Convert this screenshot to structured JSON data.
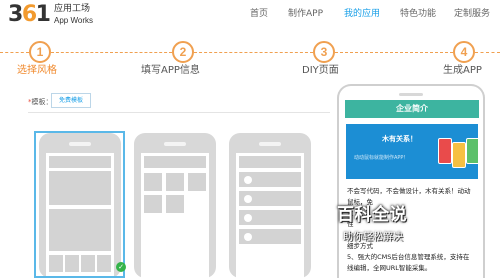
{
  "logo": {
    "number": "361",
    "cn": "应用工场",
    "en": "App Works"
  },
  "nav": {
    "items": [
      {
        "label": "首页",
        "active": false
      },
      {
        "label": "制作APP",
        "active": false
      },
      {
        "label": "我的应用",
        "active": true
      },
      {
        "label": "特色功能",
        "active": false
      },
      {
        "label": "定制服务",
        "active": false
      }
    ]
  },
  "steps": [
    {
      "number": "1",
      "label": "选择风格",
      "active": true
    },
    {
      "number": "2",
      "label": "填写APP信息",
      "active": false
    },
    {
      "number": "3",
      "label": "DIY页面",
      "active": false
    },
    {
      "number": "4",
      "label": "生成APP",
      "active": false
    }
  ],
  "template": {
    "required_mark": "*",
    "label": "模板：",
    "tab_label": "免费模板",
    "selected_index": 0,
    "check_glyph": "✓"
  },
  "preview": {
    "header_title": "企业简介",
    "banner_title": "木有关系！",
    "banner_subtitle": "动动鼠标就能制作APP！",
    "body_lines": [
      "不会写代码，不会做设计，木有关系！动动",
      "鼠标，免",
      "发",
      "性",
      "大",
      "细步方式",
      "5、强大的CMS后台信息管理系统，支持在",
      "线编辑，全网URL智能采集。"
    ]
  },
  "watermark": {
    "title": "百科全说",
    "subtitle": "助你轻松解决"
  },
  "colors": {
    "accent_orange": "#f0a050",
    "nav_active_blue": "#1aa0e8",
    "preview_header_green": "#3db4a0",
    "banner_blue": "#1c8ed4",
    "selected_border": "#5ab8e8",
    "check_green": "#35b34a"
  }
}
